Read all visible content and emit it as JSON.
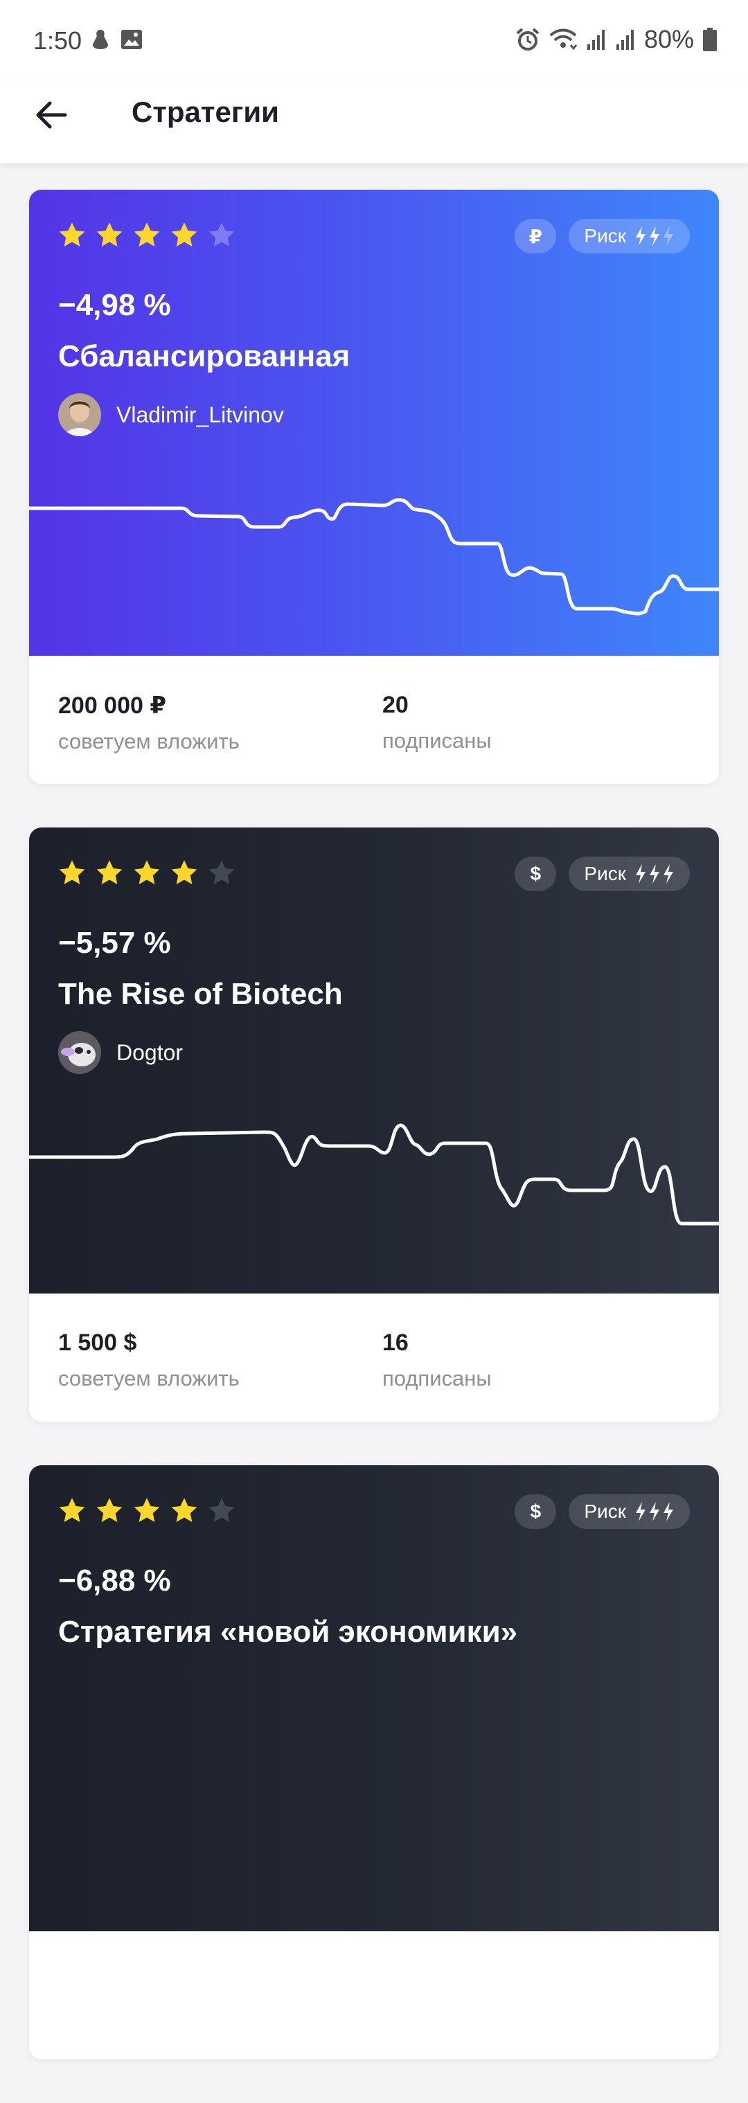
{
  "status_bar": {
    "time": "1:50",
    "battery": "80%"
  },
  "header": {
    "title": "Стратегии"
  },
  "cards": [
    {
      "theme": "purple",
      "rating": 4,
      "currency_symbol": "₽",
      "risk_label": "Риск",
      "risk_level": 2,
      "return": "−4,98 %",
      "name": "Сбалансированная",
      "author": "Vladimir_Litvinov",
      "recommended_amount": "200 000 ₽",
      "recommended_label": "советуем вложить",
      "subscribers": "20",
      "subscribers_label": "подписаны"
    },
    {
      "theme": "dark",
      "rating": 4,
      "currency_symbol": "$",
      "risk_label": "Риск",
      "risk_level": 3,
      "return": "−5,57 %",
      "name": "The Rise of Biotech",
      "author": "Dogtor",
      "recommended_amount": "1 500 $",
      "recommended_label": "советуем вложить",
      "subscribers": "16",
      "subscribers_label": "подписаны"
    },
    {
      "theme": "dark",
      "rating": 4,
      "currency_symbol": "$",
      "risk_label": "Риск",
      "risk_level": 3,
      "return": "−6,88 %",
      "name": "Стратегия «новой экономики»"
    }
  ],
  "colors": {
    "star_filled": "#fcd72b",
    "accent_purple": "#5434e6",
    "accent_blue": "#3f86fb",
    "card_dark": "#1c202b"
  }
}
